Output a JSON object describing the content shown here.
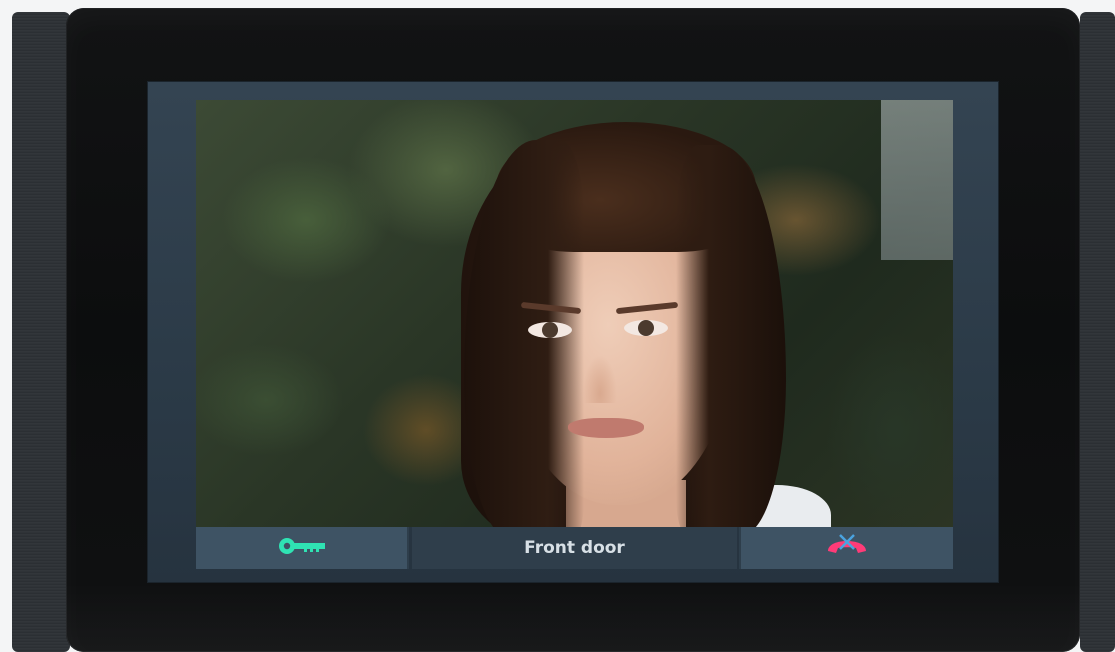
{
  "intercom": {
    "caller_label": "Front door",
    "buttons": {
      "unlock_icon": "key-icon",
      "hangup_icon": "phone-hangup-icon"
    },
    "colors": {
      "unlock_accent": "#2fe3b3",
      "hangup_accent": "#ff3b78",
      "button_bg": "#3e5364",
      "label_bg": "#2f3e4b"
    }
  }
}
